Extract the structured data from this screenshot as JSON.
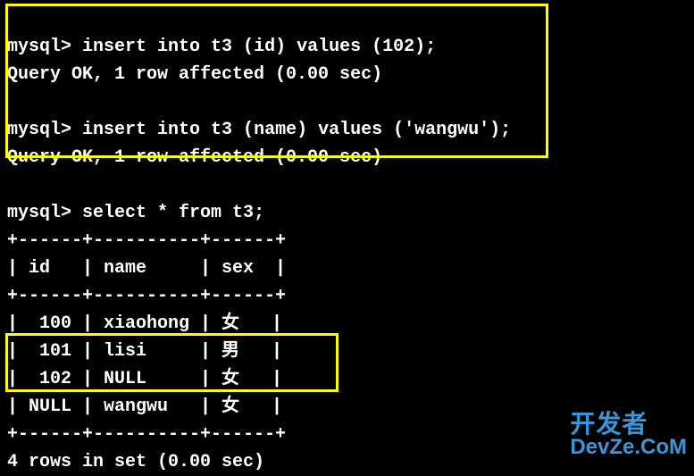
{
  "prompt": "mysql>",
  "session": {
    "cmd1": "insert into t3 (id) values (102);",
    "result1": "Query OK, 1 row affected (0.00 sec)",
    "cmd2": "insert into t3 (name) values ('wangwu');",
    "result2": "Query OK, 1 row affected (0.00 sec)",
    "cmd3": "select * from t3;",
    "result3": "4 rows in set (0.00 sec)"
  },
  "table": {
    "border_top": "+------+----------+------+",
    "border_mid": "+------+----------+------+",
    "border_bottom": "+------+----------+------+",
    "header": "| id   | name     | sex  |",
    "rows": [
      "|  100 | xiaohong | 女   |",
      "|  101 | lisi     | 男   |",
      "|  102 | NULL     | 女   |",
      "| NULL | wangwu   | 女   |"
    ]
  },
  "watermark": {
    "line1": "开发者",
    "line2": "DevZe.CoM"
  }
}
